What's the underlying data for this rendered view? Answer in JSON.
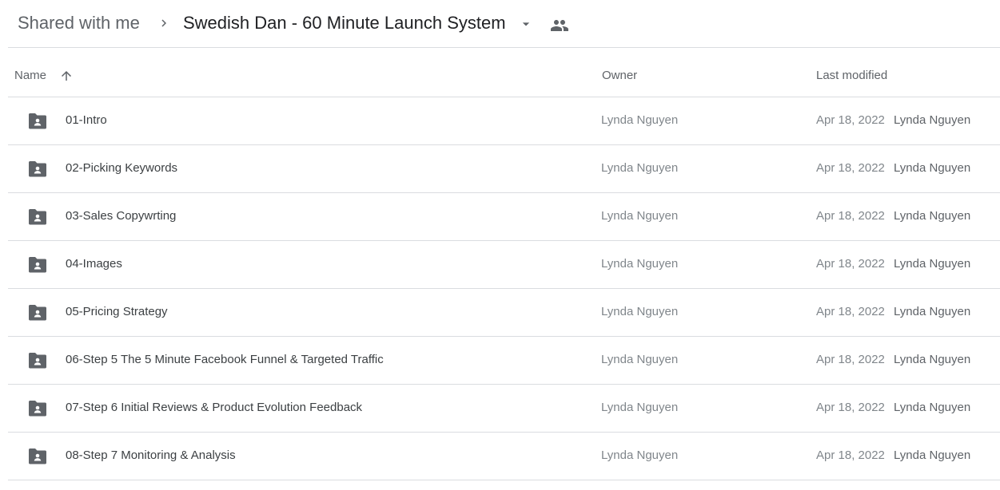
{
  "breadcrumb": {
    "root": "Shared with me",
    "current": "Swedish Dan - 60 Minute Launch System",
    "separator_icon": "chevron-right-icon",
    "dropdown_icon": "caret-down-icon",
    "shared_icon": "people-icon"
  },
  "columns": {
    "name": "Name",
    "owner": "Owner",
    "last_modified": "Last modified",
    "sort_icon": "arrow-up-icon"
  },
  "colors": {
    "icon": "#5f6368",
    "divider": "#dadce0",
    "text_primary": "#3c4043",
    "text_secondary": "#80868b"
  },
  "rows": [
    {
      "name": "01-Intro",
      "owner": "Lynda Nguyen",
      "modified_date": "Apr 18, 2022",
      "modified_by": "Lynda Nguyen",
      "icon": "shared-folder-icon"
    },
    {
      "name": "02-Picking Keywords",
      "owner": "Lynda Nguyen",
      "modified_date": "Apr 18, 2022",
      "modified_by": "Lynda Nguyen",
      "icon": "shared-folder-icon"
    },
    {
      "name": "03-Sales Copywrting",
      "owner": "Lynda Nguyen",
      "modified_date": "Apr 18, 2022",
      "modified_by": "Lynda Nguyen",
      "icon": "shared-folder-icon"
    },
    {
      "name": "04-Images",
      "owner": "Lynda Nguyen",
      "modified_date": "Apr 18, 2022",
      "modified_by": "Lynda Nguyen",
      "icon": "shared-folder-icon"
    },
    {
      "name": "05-Pricing Strategy",
      "owner": "Lynda Nguyen",
      "modified_date": "Apr 18, 2022",
      "modified_by": "Lynda Nguyen",
      "icon": "shared-folder-icon"
    },
    {
      "name": "06-Step 5 The 5 Minute Facebook Funnel & Targeted Traffic",
      "owner": "Lynda Nguyen",
      "modified_date": "Apr 18, 2022",
      "modified_by": "Lynda Nguyen",
      "icon": "shared-folder-icon"
    },
    {
      "name": "07-Step 6 Initial Reviews & Product Evolution Feedback",
      "owner": "Lynda Nguyen",
      "modified_date": "Apr 18, 2022",
      "modified_by": "Lynda Nguyen",
      "icon": "shared-folder-icon"
    },
    {
      "name": "08-Step 7 Monitoring & Analysis",
      "owner": "Lynda Nguyen",
      "modified_date": "Apr 18, 2022",
      "modified_by": "Lynda Nguyen",
      "icon": "shared-folder-icon"
    }
  ]
}
